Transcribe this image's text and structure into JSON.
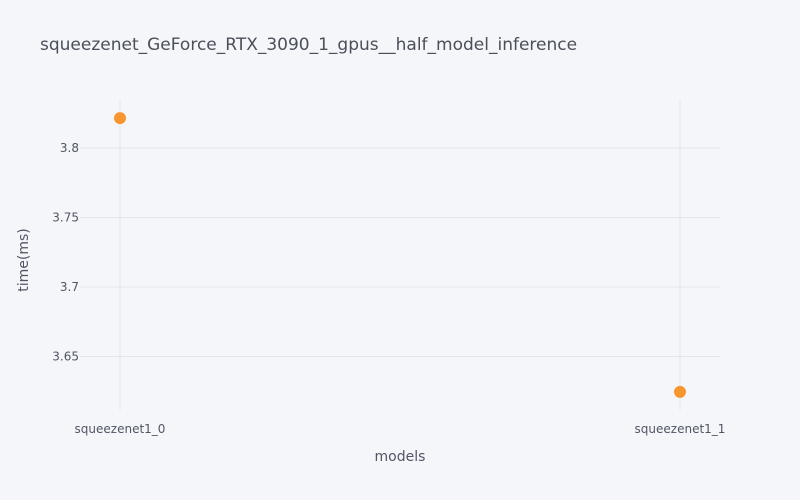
{
  "chart_data": {
    "type": "scatter",
    "title": "squeezenet_GeForce_RTX_3090_1_gpus__half_model_inference",
    "xlabel": "models",
    "ylabel": "time(ms)",
    "categories": [
      "squeezenet1_0",
      "squeezenet1_1"
    ],
    "series": [
      {
        "values": [
          3.8215,
          3.6245
        ],
        "color": "#f7962f"
      }
    ],
    "yticks": [
      3.65,
      3.7,
      3.75,
      3.8
    ],
    "ytick_labels": [
      "3.65",
      "3.7",
      "3.75",
      "3.8"
    ],
    "ylim": [
      3.6115,
      3.8345
    ],
    "grid": true,
    "background": "#f5f6f9",
    "grid_color": "#e4e6ec"
  }
}
